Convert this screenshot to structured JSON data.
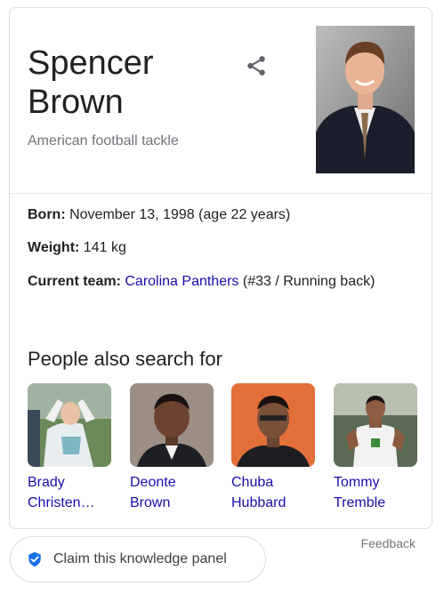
{
  "entity": {
    "name_line1": "Spencer",
    "name_line2": "Brown",
    "subtitle": "American football tackle",
    "share_icon": "share-icon",
    "photo_alt": "Spencer Brown"
  },
  "facts": [
    {
      "label": "Born:",
      "value": " November 13, 1998 (age 22 years)"
    },
    {
      "label": "Weight:",
      "value": " 141 kg"
    },
    {
      "label": "Current team:",
      "link": "Carolina Panthers",
      "value": " (#33 / Running back)"
    }
  ],
  "people_also_search": {
    "title": "People also search for",
    "items": [
      {
        "line1": "Brady",
        "line2": "Christen…"
      },
      {
        "line1": "Deonte",
        "line2": "Brown"
      },
      {
        "line1": "Chuba",
        "line2": "Hubbard"
      },
      {
        "line1": "Tommy",
        "line2": "Tremble"
      }
    ]
  },
  "footer": {
    "feedback": "Feedback",
    "claim_label": "Claim this knowledge panel",
    "claim_icon": "verified-shield-icon"
  },
  "colors": {
    "link": "#1a0dab",
    "secondary_text": "#70757a",
    "badge_blue": "#1a73e8"
  }
}
